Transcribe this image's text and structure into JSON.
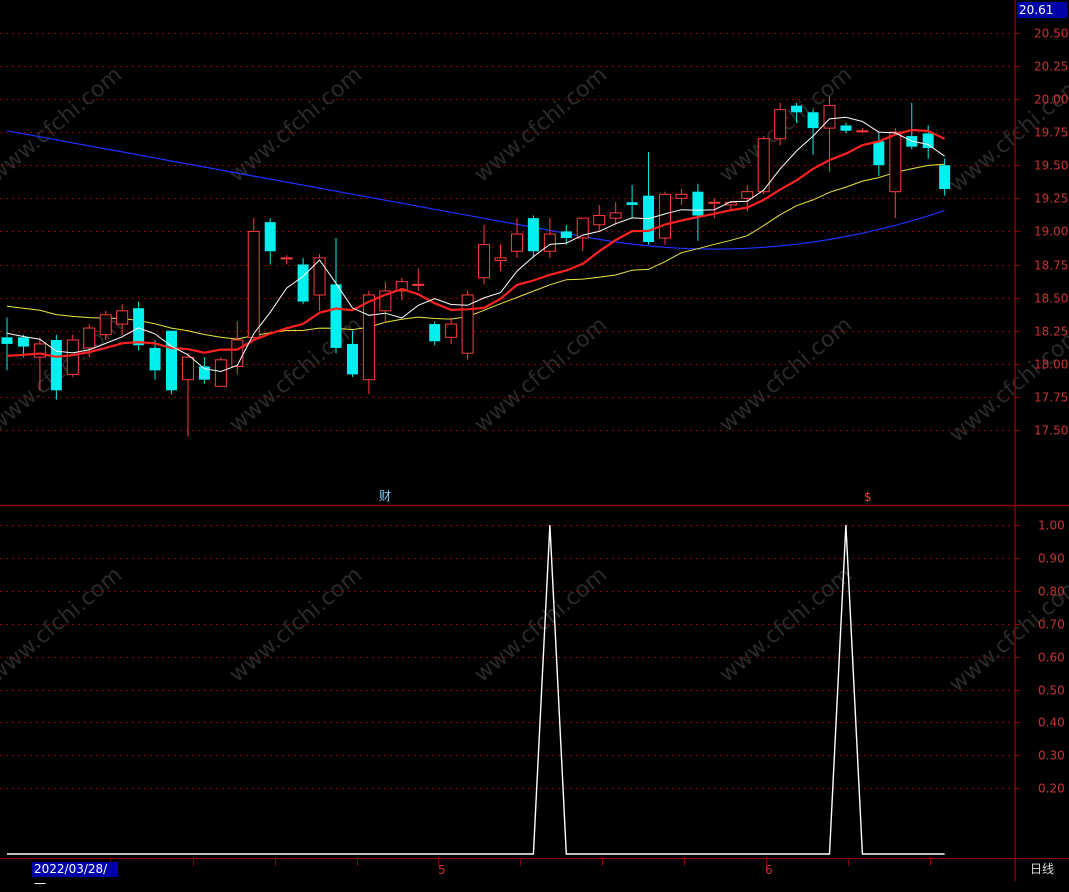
{
  "header": {
    "last_price": "20.61"
  },
  "footer": {
    "date_cursor": "2022/03/28/一",
    "period": "日线",
    "month_labels": [
      "5",
      "6"
    ]
  },
  "markers": {
    "finance": "财",
    "dividend": "$"
  },
  "watermark": "www.cfchi.com",
  "colors": {
    "up": "#ff3c3c",
    "down": "#00f0f0",
    "ma5": "#ffffff",
    "ma10": "#ff2020",
    "ma20": "#e8e840",
    "ma60": "#2030ff",
    "grid": "#8b0000",
    "axis_text": "#c83232",
    "indicator": "#ffffff"
  },
  "chart_data": [
    {
      "type": "candlestick",
      "yticks": [
        "20.50",
        "20.25",
        "20.00",
        "19.75",
        "19.50",
        "19.25",
        "19.00",
        "18.75",
        "18.50",
        "18.25",
        "18.00",
        "17.75",
        "17.50"
      ],
      "ylim": [
        17.2,
        20.75
      ],
      "candles": [
        {
          "o": 18.2,
          "h": 18.35,
          "l": 17.95,
          "c": 18.15
        },
        {
          "o": 18.2,
          "h": 18.22,
          "l": 18.05,
          "c": 18.13
        },
        {
          "o": 18.05,
          "h": 18.2,
          "l": 17.8,
          "c": 18.15
        },
        {
          "o": 18.18,
          "h": 18.22,
          "l": 17.73,
          "c": 17.8
        },
        {
          "o": 17.92,
          "h": 18.22,
          "l": 17.9,
          "c": 18.18
        },
        {
          "o": 18.12,
          "h": 18.3,
          "l": 18.05,
          "c": 18.27
        },
        {
          "o": 18.22,
          "h": 18.4,
          "l": 18.18,
          "c": 18.37
        },
        {
          "o": 18.3,
          "h": 18.45,
          "l": 18.22,
          "c": 18.4
        },
        {
          "o": 18.42,
          "h": 18.47,
          "l": 18.1,
          "c": 18.14
        },
        {
          "o": 18.12,
          "h": 18.18,
          "l": 17.88,
          "c": 17.95
        },
        {
          "o": 18.25,
          "h": 18.25,
          "l": 17.77,
          "c": 17.8
        },
        {
          "o": 17.88,
          "h": 18.08,
          "l": 17.45,
          "c": 18.05
        },
        {
          "o": 17.98,
          "h": 18.05,
          "l": 17.85,
          "c": 17.88
        },
        {
          "o": 17.83,
          "h": 18.05,
          "l": 17.83,
          "c": 18.03
        },
        {
          "o": 17.98,
          "h": 18.32,
          "l": 17.92,
          "c": 18.18
        },
        {
          "o": 18.2,
          "h": 19.1,
          "l": 18.18,
          "c": 19.0
        },
        {
          "o": 19.07,
          "h": 19.1,
          "l": 18.75,
          "c": 18.85
        },
        {
          "o": 18.8,
          "h": 18.82,
          "l": 18.75,
          "c": 18.8
        },
        {
          "o": 18.75,
          "h": 18.8,
          "l": 18.45,
          "c": 18.47
        },
        {
          "o": 18.52,
          "h": 18.83,
          "l": 18.4,
          "c": 18.8
        },
        {
          "o": 18.6,
          "h": 18.95,
          "l": 18.08,
          "c": 18.12
        },
        {
          "o": 18.15,
          "h": 18.25,
          "l": 17.9,
          "c": 17.92
        },
        {
          "o": 17.88,
          "h": 18.55,
          "l": 17.77,
          "c": 18.52
        },
        {
          "o": 18.4,
          "h": 18.62,
          "l": 18.32,
          "c": 18.55
        },
        {
          "o": 18.55,
          "h": 18.65,
          "l": 18.48,
          "c": 18.62
        },
        {
          "o": 18.6,
          "h": 18.72,
          "l": 18.55,
          "c": 18.6
        },
        {
          "o": 18.3,
          "h": 18.32,
          "l": 18.14,
          "c": 18.17
        },
        {
          "o": 18.2,
          "h": 18.35,
          "l": 18.15,
          "c": 18.3
        },
        {
          "o": 18.08,
          "h": 18.55,
          "l": 18.03,
          "c": 18.52
        },
        {
          "o": 18.65,
          "h": 19.05,
          "l": 18.6,
          "c": 18.9
        },
        {
          "o": 18.78,
          "h": 18.9,
          "l": 18.7,
          "c": 18.8
        },
        {
          "o": 18.85,
          "h": 19.1,
          "l": 18.8,
          "c": 18.98
        },
        {
          "o": 19.1,
          "h": 19.12,
          "l": 18.8,
          "c": 18.85
        },
        {
          "o": 18.85,
          "h": 19.1,
          "l": 18.8,
          "c": 18.98
        },
        {
          "o": 19.0,
          "h": 19.05,
          "l": 18.9,
          "c": 18.95
        },
        {
          "o": 18.95,
          "h": 19.1,
          "l": 18.85,
          "c": 19.1
        },
        {
          "o": 19.05,
          "h": 19.2,
          "l": 19.0,
          "c": 19.12
        },
        {
          "o": 19.1,
          "h": 19.22,
          "l": 19.05,
          "c": 19.14
        },
        {
          "o": 19.22,
          "h": 19.35,
          "l": 19.1,
          "c": 19.2
        },
        {
          "o": 19.27,
          "h": 19.6,
          "l": 18.9,
          "c": 18.92
        },
        {
          "o": 18.95,
          "h": 19.3,
          "l": 18.9,
          "c": 19.28
        },
        {
          "o": 19.25,
          "h": 19.32,
          "l": 19.2,
          "c": 19.28
        },
        {
          "o": 19.3,
          "h": 19.36,
          "l": 18.93,
          "c": 19.12
        },
        {
          "o": 19.22,
          "h": 19.25,
          "l": 19.1,
          "c": 19.22
        },
        {
          "o": 19.2,
          "h": 19.23,
          "l": 19.15,
          "c": 19.22
        },
        {
          "o": 19.25,
          "h": 19.35,
          "l": 19.15,
          "c": 19.3
        },
        {
          "o": 19.3,
          "h": 19.72,
          "l": 19.28,
          "c": 19.7
        },
        {
          "o": 19.7,
          "h": 19.97,
          "l": 19.65,
          "c": 19.92
        },
        {
          "o": 19.95,
          "h": 19.97,
          "l": 19.82,
          "c": 19.9
        },
        {
          "o": 19.9,
          "h": 19.92,
          "l": 19.58,
          "c": 19.78
        },
        {
          "o": 19.78,
          "h": 20.02,
          "l": 19.45,
          "c": 19.95
        },
        {
          "o": 19.8,
          "h": 19.82,
          "l": 19.74,
          "c": 19.76
        },
        {
          "o": 19.76,
          "h": 19.78,
          "l": 19.74,
          "c": 19.76
        },
        {
          "o": 19.68,
          "h": 19.75,
          "l": 19.42,
          "c": 19.5
        },
        {
          "o": 19.3,
          "h": 19.78,
          "l": 19.1,
          "c": 19.75
        },
        {
          "o": 19.72,
          "h": 19.97,
          "l": 19.62,
          "c": 19.64
        },
        {
          "o": 19.74,
          "h": 19.8,
          "l": 19.55,
          "c": 19.63
        },
        {
          "o": 19.5,
          "h": 19.55,
          "l": 19.27,
          "c": 19.32
        }
      ]
    },
    {
      "type": "line",
      "yticks": [
        "1.00",
        "0.90",
        "0.80",
        "0.70",
        "0.60",
        "0.50",
        "0.40",
        "0.30",
        "0.20"
      ],
      "ylim": [
        0,
        1
      ],
      "values": [
        0,
        0,
        0,
        0,
        0,
        0,
        0,
        0,
        0,
        0,
        0,
        0,
        0,
        0,
        0,
        0,
        0,
        0,
        0,
        0,
        0,
        0,
        0,
        0,
        0,
        0,
        0,
        0,
        0,
        0,
        0,
        0,
        0,
        1,
        0,
        0,
        0,
        0,
        0,
        0,
        0,
        0,
        0,
        0,
        0,
        0,
        0,
        0,
        0,
        0,
        0,
        1,
        0,
        0,
        0,
        0,
        0,
        0
      ]
    }
  ]
}
